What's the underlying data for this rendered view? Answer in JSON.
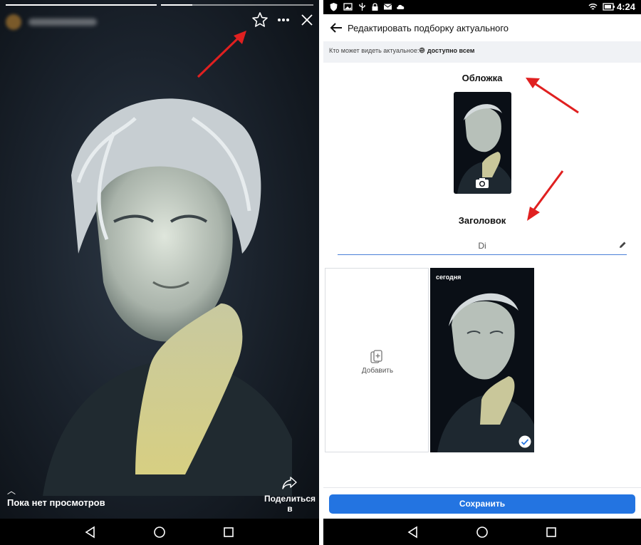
{
  "story_viewer": {
    "views_text": "Пока нет просмотров",
    "share_label_line1": "Поделиться",
    "share_label_line2": "в",
    "top_icons": [
      "star-icon",
      "more-icon",
      "close-icon"
    ]
  },
  "edit_highlight": {
    "status_time": "4:24",
    "title": "Редактировать подборку актуального",
    "visibility_prefix": "Кто может видеть актуальное:",
    "visibility_value": "доступно всем",
    "cover_label": "Обложка",
    "heading_label": "Заголовок",
    "heading_value": "Di",
    "add_label": "Добавить",
    "story_date": "сегодня",
    "save_label": "Сохранить"
  },
  "colors": {
    "accent": "#2374e1",
    "annotation_arrow": "#e02020"
  }
}
